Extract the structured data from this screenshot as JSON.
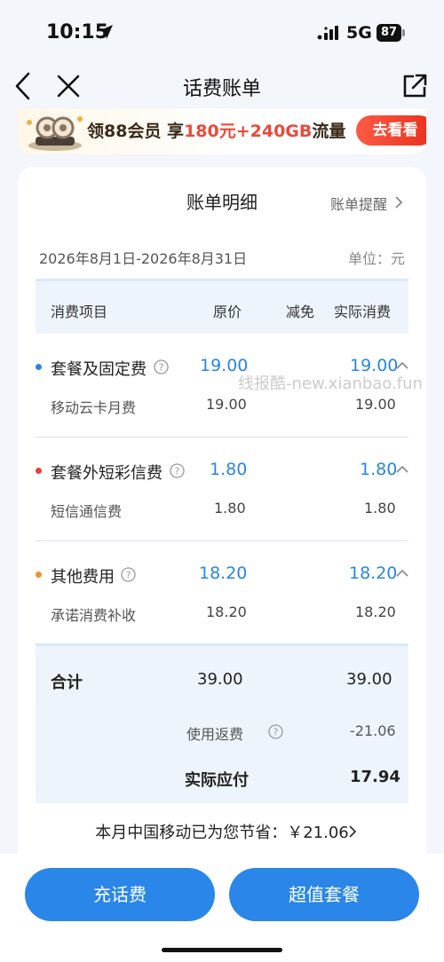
{
  "status_bar": {
    "time": "10:15",
    "network": "5G",
    "battery": "87"
  },
  "nav": {
    "title": "话费账单"
  },
  "banner": {
    "text_prefix": "领88会员 享",
    "text_highlight": "180元+240GB",
    "text_suffix": "流量",
    "button": "去看看"
  },
  "bill": {
    "title": "账单明细",
    "remind": "账单提醒",
    "period": "2026年8月1日-2026年8月31日",
    "unit": "单位：元",
    "columns": {
      "item": "消费项目",
      "price": "原价",
      "discount": "减免",
      "actual": "实际消费"
    },
    "categories": [
      {
        "name": "套餐及固定费",
        "price": "19.00",
        "actual": "19.00",
        "dot_color": "#2a86e0",
        "sub_name": "移动云卡月费",
        "sub_price": "19.00",
        "sub_actual": "19.00"
      },
      {
        "name": "套餐外短彩信费",
        "price": "1.80",
        "actual": "1.80",
        "dot_color": "#e8403a",
        "sub_name": "短信通信费",
        "sub_price": "1.80",
        "sub_actual": "1.80"
      },
      {
        "name": "其他费用",
        "price": "18.20",
        "actual": "18.20",
        "dot_color": "#e8962a",
        "sub_name": "承诺消费补收",
        "sub_price": "18.20",
        "sub_actual": "18.20"
      }
    ],
    "total": {
      "label": "合计",
      "price": "39.00",
      "actual": "39.00"
    },
    "rebate": {
      "label": "使用返费",
      "value": "-21.06"
    },
    "payable": {
      "label": "实际应付",
      "value": "17.94"
    },
    "saving": "本月中国移动已为您节省：￥21.06"
  },
  "buttons": {
    "recharge": "充话费",
    "package": "超值套餐"
  },
  "watermark": "线报酷-new.xianbao.fun"
}
